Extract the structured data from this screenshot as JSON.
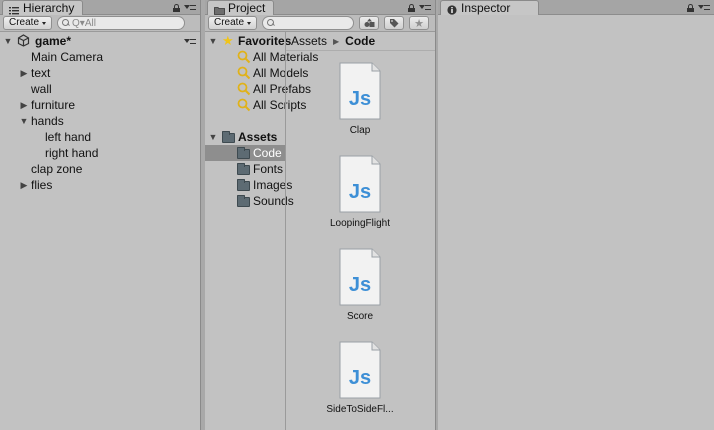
{
  "hierarchy": {
    "tab_label": "Hierarchy",
    "create_label": "Create",
    "search_placeholder": "Q▾All",
    "scene": "game*",
    "items": [
      {
        "label": "Main Camera",
        "depth": 1,
        "expander": "none"
      },
      {
        "label": "text",
        "depth": 1,
        "expander": "collapsed"
      },
      {
        "label": "wall",
        "depth": 1,
        "expander": "none"
      },
      {
        "label": "furniture",
        "depth": 1,
        "expander": "collapsed"
      },
      {
        "label": "hands",
        "depth": 1,
        "expander": "expanded"
      },
      {
        "label": "left hand",
        "depth": 2,
        "expander": "none"
      },
      {
        "label": "right hand",
        "depth": 2,
        "expander": "none"
      },
      {
        "label": "clap zone",
        "depth": 1,
        "expander": "none"
      },
      {
        "label": "flies",
        "depth": 1,
        "expander": "collapsed"
      }
    ]
  },
  "project": {
    "tab_label": "Project",
    "create_label": "Create",
    "favorites_label": "Favorites",
    "favorites": [
      "All Materials",
      "All Models",
      "All Prefabs",
      "All Scripts"
    ],
    "assets_label": "Assets",
    "folders": [
      "Code",
      "Fonts",
      "Images",
      "Sounds"
    ],
    "selected_folder": "Code",
    "breadcrumb": {
      "root": "Assets",
      "current": "Code"
    },
    "files": [
      "Clap",
      "LoopingFlight",
      "Score",
      "SideToSideFl..."
    ]
  },
  "inspector": {
    "tab_label": "Inspector"
  },
  "colors": {
    "panel_bg": "#c2c2c2",
    "selection": "#8e8e8e",
    "favorite_star": "#f0c419",
    "js_icon_text": "#3d8fd6"
  }
}
